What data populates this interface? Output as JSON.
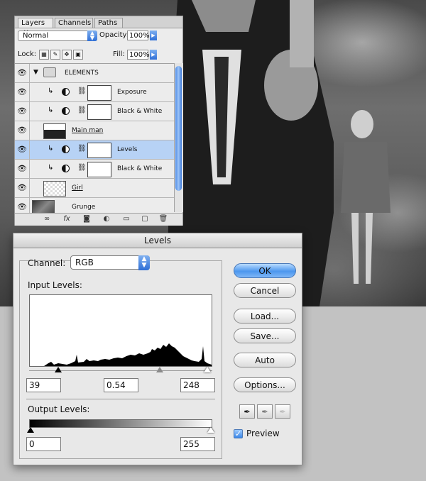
{
  "layers_panel": {
    "tabs": [
      "Layers",
      "Channels",
      "Paths"
    ],
    "active_tab": "Layers",
    "tab_close_glyph": "✕",
    "blend_mode": "Normal",
    "opacity_label": "Opacity:",
    "opacity_value": "100%",
    "lock_label": "Lock:",
    "fill_label": "Fill:",
    "fill_value": "100%",
    "layers": [
      {
        "name": "ELEMENTS",
        "kind": "group",
        "visible": true
      },
      {
        "name": "Exposure",
        "kind": "adjustment",
        "clipped": true,
        "visible": true
      },
      {
        "name": "Black & White",
        "kind": "adjustment",
        "clipped": true,
        "visible": true
      },
      {
        "name": "Main man",
        "kind": "image",
        "underline": true,
        "visible": true
      },
      {
        "name": "Levels",
        "kind": "adjustment",
        "clipped": true,
        "selected": true,
        "visible": true
      },
      {
        "name": "Black & White",
        "kind": "adjustment",
        "clipped": true,
        "visible": true
      },
      {
        "name": "Girl",
        "kind": "image",
        "underline": true,
        "visible": true
      },
      {
        "name": "Grunge",
        "kind": "image",
        "visible": true
      }
    ],
    "footer_icons": [
      "link-icon",
      "fx-icon",
      "mask-icon",
      "adjustment-icon",
      "folder-icon",
      "new-layer-icon",
      "trash-icon"
    ]
  },
  "levels_dialog": {
    "title": "Levels",
    "channel_label": "Channel:",
    "channel_value": "RGB",
    "input_levels_label": "Input Levels:",
    "input_black": "39",
    "input_gamma": "0.54",
    "input_white": "248",
    "output_levels_label": "Output Levels:",
    "output_black": "0",
    "output_white": "255",
    "buttons": {
      "ok": "OK",
      "cancel": "Cancel",
      "load": "Load...",
      "save": "Save...",
      "auto": "Auto",
      "options": "Options..."
    },
    "preview_label": "Preview",
    "preview_checked": true,
    "eyedroppers": [
      "black-eyedropper-icon",
      "gray-eyedropper-icon",
      "white-eyedropper-icon"
    ]
  },
  "colors": {
    "accent_blue": "#4c97ee",
    "selected_row": "#b7d2f5"
  }
}
